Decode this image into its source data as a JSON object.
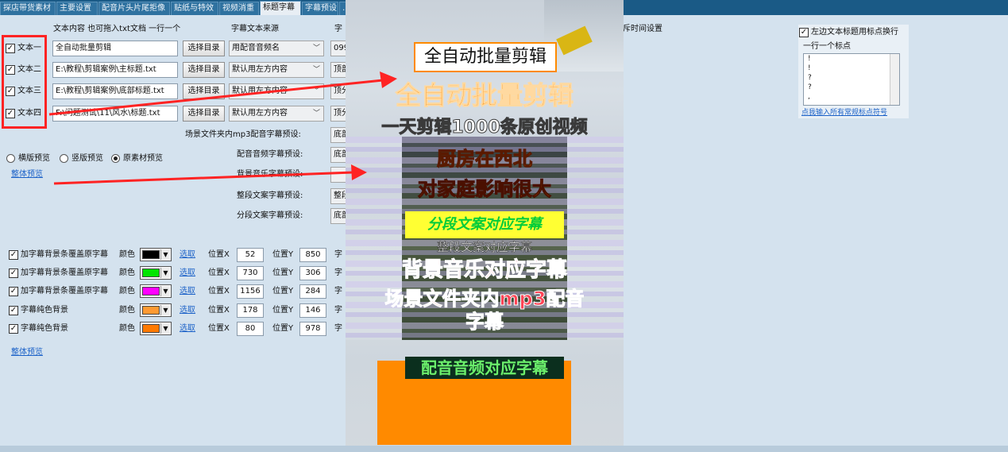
{
  "tabs": [
    {
      "label": "探店带货素材"
    },
    {
      "label": "主要设置"
    },
    {
      "label": "配音片头片尾拒像"
    },
    {
      "label": "贴纸与特效"
    },
    {
      "label": "视频消重"
    },
    {
      "label": "标题字幕"
    },
    {
      "label": "字幕预设"
    },
    {
      "label": "…"
    }
  ],
  "text_section": {
    "header_content": "文本内容 也可拖入txt文档 一行一个",
    "header_source": "字幕文本来源",
    "header_col3": "字",
    "rows": [
      {
        "label": "文本一",
        "value": "全自动批量剪辑",
        "button": "选择目录",
        "source": "用配音音频名",
        "col3": "099"
      },
      {
        "label": "文本二",
        "value": "E:\\教程\\剪辑案例\\主标题.txt",
        "button": "选择目录",
        "source": "默认用左方内容",
        "col3": "顶部"
      },
      {
        "label": "文本三",
        "value": "E:\\教程\\剪辑案例\\底部标题.txt",
        "button": "选择目录",
        "source": "默认用左方内容",
        "col3": "顶分"
      },
      {
        "label": "文本四",
        "value": "F:\\问题测试\\11\\风水\\标题.txt",
        "button": "选择目录",
        "source": "默认用左方内容",
        "col3": "顶分"
      }
    ]
  },
  "presets": [
    {
      "label": "场景文件夹内mp3配音字幕预设:",
      "value": "底部"
    },
    {
      "label": "配音音频字幕预设:",
      "value": "底部"
    },
    {
      "label": "背景音乐字幕预设:",
      "value": ""
    },
    {
      "label": "整段文案字幕预设:",
      "value": "整段"
    },
    {
      "label": "分段文案字幕预设:",
      "value": "底部"
    }
  ],
  "preview_mode": {
    "options": [
      "横版预览",
      "竖版预览",
      "原素材预览"
    ],
    "selected": "原素材预览",
    "overall_link": "整体预览"
  },
  "color_rows": [
    {
      "label": "加字幕背景条覆盖原字幕",
      "color_label": "颜色",
      "color": "#000000",
      "pick": "选取",
      "x_label": "位置X",
      "x": "52",
      "y_label": "位置Y",
      "y": "850",
      "tail": "字"
    },
    {
      "label": "加字幕背景条覆盖原字幕",
      "color_label": "颜色",
      "color": "#00e400",
      "pick": "选取",
      "x_label": "位置X",
      "x": "730",
      "y_label": "位置Y",
      "y": "306",
      "tail": "字"
    },
    {
      "label": "加字幕背景条覆盖原字幕",
      "color_label": "颜色",
      "color": "#ff00ff",
      "pick": "选取",
      "x_label": "位置X",
      "x": "1156",
      "y_label": "位置Y",
      "y": "284",
      "tail": "字"
    },
    {
      "label": "字幕纯色背景",
      "color_label": "颜色",
      "color": "#ff9a33",
      "pick": "选取",
      "x_label": "位置X",
      "x": "178",
      "y_label": "位置Y",
      "y": "146",
      "tail": "字"
    },
    {
      "label": "字幕纯色背景",
      "color_label": "颜色",
      "color": "#ff7a00",
      "pick": "选取",
      "x_label": "位置X",
      "x": "80",
      "y_label": "位置Y",
      "y": "978",
      "tail": "字"
    }
  ],
  "overall_link2": "整体预览",
  "time_settings": "斥时间设置",
  "right_panel": {
    "checkbox_label": "左边文本标题用标点换行",
    "list_title": "一行一个标点",
    "punct": [
      "!",
      "!",
      "?",
      "?",
      ","
    ],
    "link": "点我输入所有常规标点符号"
  },
  "preview": {
    "line1": "全自动批量剪辑",
    "line2": "全自动批量剪辑",
    "line3": "一天剪辑1000条原创视频",
    "line4": "厨房在西北",
    "line5": "对家庭影响很大",
    "line6": "分段文案对应字幕",
    "line7": "整段文案对应字幕",
    "line8": "背景音乐对应字幕",
    "line9": "场景文件夹内mp3配音",
    "line10": "字幕",
    "line11": "配音音频对应字幕"
  },
  "colors": {
    "tabbar": "#1a5a86",
    "highlight_red": "#ff2323",
    "preview_orange": "#ff8a00"
  }
}
